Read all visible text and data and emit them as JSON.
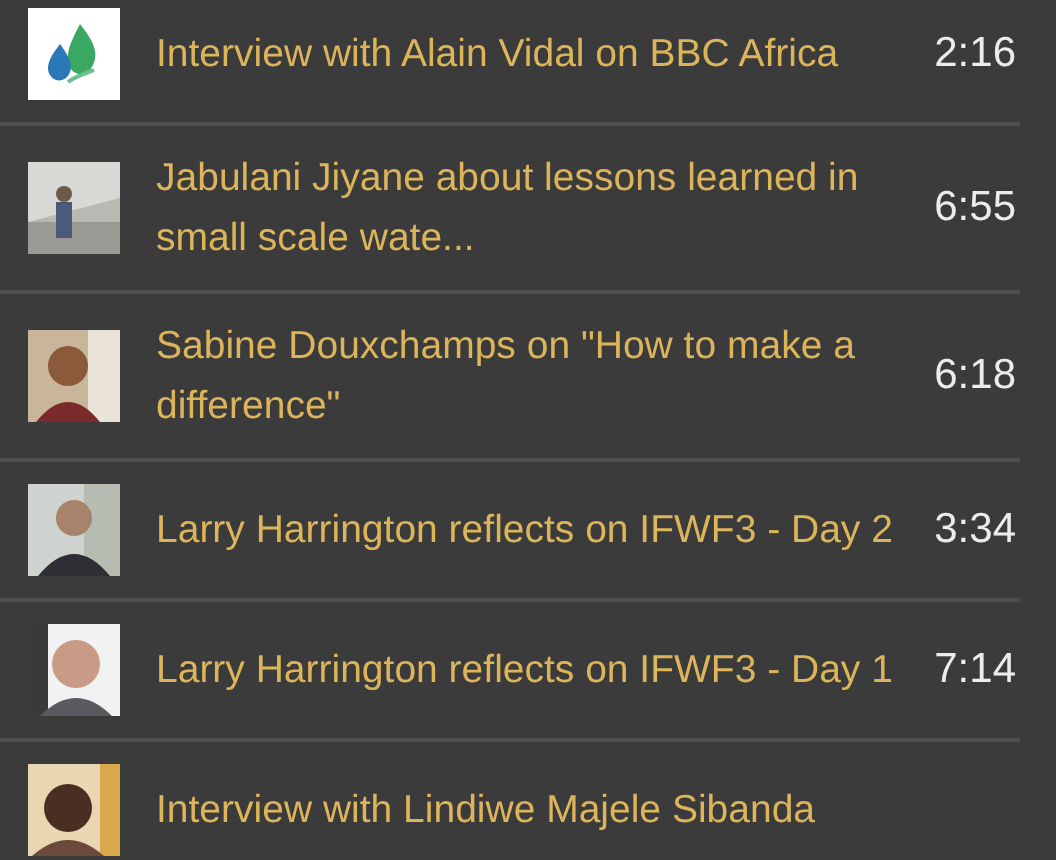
{
  "videos": [
    {
      "kind": "logo",
      "title": "Interview with Alain Vidal on BBC Africa",
      "duration": "2:16"
    },
    {
      "title": "Jabulani Jiyane about lessons learned in small scale wate...",
      "duration": "6:55"
    },
    {
      "title": "Sabine Douxchamps on \"How to make a difference\"",
      "duration": "6:18"
    },
    {
      "title": "Larry Harrington reflects on IFWF3 - Day 2",
      "duration": "3:34"
    },
    {
      "title": "Larry Harrington reflects on IFWF3 - Day 1",
      "duration": "7:14"
    },
    {
      "title": "Interview with Lindiwe Majele Sibanda"
    }
  ]
}
